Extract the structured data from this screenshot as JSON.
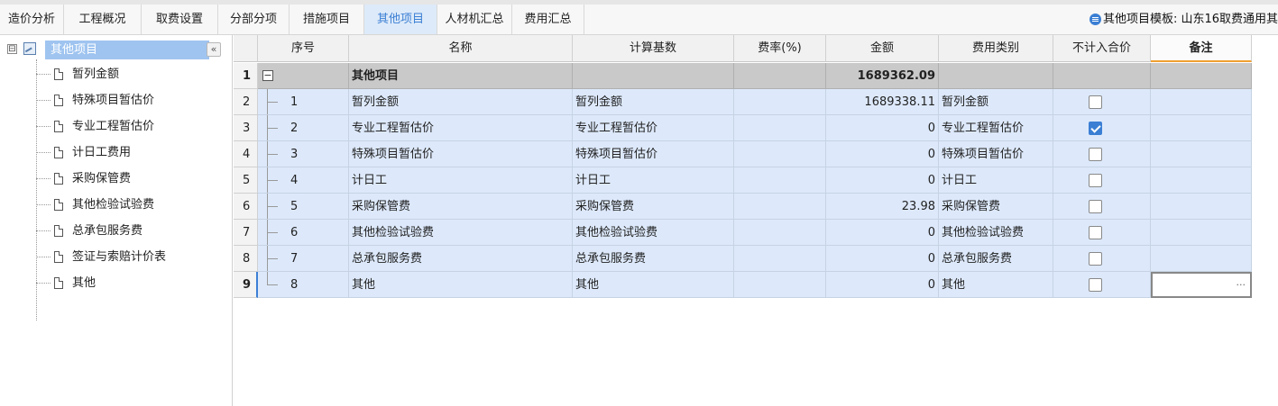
{
  "tabs": [
    {
      "label": "造价分析",
      "active": false
    },
    {
      "label": "工程概况",
      "active": false
    },
    {
      "label": "取费设置",
      "active": false
    },
    {
      "label": "分部分项",
      "active": false
    },
    {
      "label": "措施项目",
      "active": false
    },
    {
      "label": "其他项目",
      "active": true
    },
    {
      "label": "人材机汇总",
      "active": false
    },
    {
      "label": "费用汇总",
      "active": false
    }
  ],
  "template_info": "其他项目模板: 山东16取费通用其",
  "tree": {
    "root_label": "其他项目",
    "toggle": "⊟",
    "collapse_button": "«",
    "items": [
      "暂列金额",
      "特殊项目暂估价",
      "专业工程暂估价",
      "计日工费用",
      "采购保管费",
      "其他检验试验费",
      "总承包服务费",
      "签证与索赔计价表",
      "其他"
    ]
  },
  "table": {
    "headers": {
      "seq": "序号",
      "name": "名称",
      "base": "计算基数",
      "rate": "费率(%)",
      "amount": "金额",
      "category": "费用类别",
      "exclude": "不计入合价",
      "note": "备注"
    },
    "top_row": {
      "row_no": "1",
      "name": "其他项目",
      "amount": "1689362.09"
    },
    "rows": [
      {
        "row_no": "2",
        "seq": "1",
        "name": "暂列金额",
        "base": "暂列金额",
        "amount": "1689338.11",
        "category": "暂列金额",
        "excluded": false
      },
      {
        "row_no": "3",
        "seq": "2",
        "name": "专业工程暂估价",
        "base": "专业工程暂估价",
        "amount": "0",
        "category": "专业工程暂估价",
        "excluded": true
      },
      {
        "row_no": "4",
        "seq": "3",
        "name": "特殊项目暂估价",
        "base": "特殊项目暂估价",
        "amount": "0",
        "category": "特殊项目暂估价",
        "excluded": false
      },
      {
        "row_no": "5",
        "seq": "4",
        "name": "计日工",
        "base": "计日工",
        "amount": "0",
        "category": "计日工",
        "excluded": false
      },
      {
        "row_no": "6",
        "seq": "5",
        "name": "采购保管费",
        "base": "采购保管费",
        "amount": "23.98",
        "category": "采购保管费",
        "excluded": false
      },
      {
        "row_no": "7",
        "seq": "6",
        "name": "其他检验试验费",
        "base": "其他检验试验费",
        "amount": "0",
        "category": "其他检验试验费",
        "excluded": false
      },
      {
        "row_no": "8",
        "seq": "7",
        "name": "总承包服务费",
        "base": "总承包服务费",
        "amount": "0",
        "category": "总承包服务费",
        "excluded": false
      },
      {
        "row_no": "9",
        "seq": "8",
        "name": "其他",
        "base": "其他",
        "amount": "0",
        "category": "其他",
        "excluded": false
      }
    ],
    "note_ellipsis": "···"
  },
  "colors": {
    "accent": "#3b7fd4",
    "row_bg": "#dde9fb",
    "top_row_bg": "#c9c9c9",
    "tree_selected": "#9fc4f0"
  }
}
